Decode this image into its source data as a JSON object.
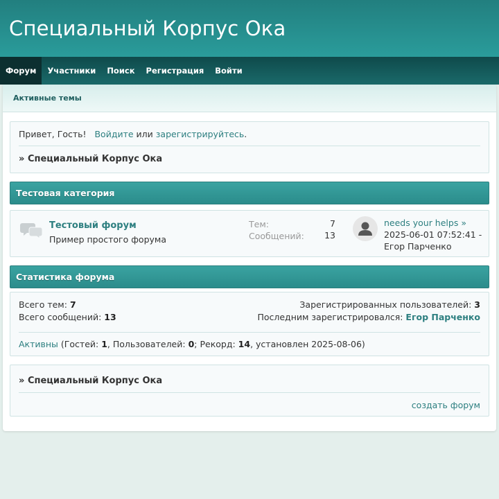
{
  "site": {
    "title": "Специальный Корпус Ока"
  },
  "nav": [
    {
      "label": "Форум",
      "active": true
    },
    {
      "label": "Участники"
    },
    {
      "label": "Поиск"
    },
    {
      "label": "Регистрация"
    },
    {
      "label": "Войти"
    }
  ],
  "active_topics_label": "Активные темы",
  "welcome": {
    "greeting": "Привет, Гость!",
    "login_link": "Войдите",
    "or": "или",
    "register_link": "зарегистрируйтесь",
    "period": "."
  },
  "breadcrumb": {
    "arrow": "»",
    "title": "Специальный Корпус Ока"
  },
  "category": {
    "title": "Тестовая категория",
    "forum": {
      "icon": "speech-bubbles-icon",
      "name": "Тестовый форум",
      "description": "Пример простого форума",
      "topics_label": "Тем:",
      "topics_count": "7",
      "posts_label": "Сообщений:",
      "posts_count": "13",
      "last_post": {
        "avatar_icon": "default-user-avatar-icon",
        "title": "needs your helps",
        "arrow": "»",
        "datetime": "2025-06-01 07:52:41 -",
        "author": "Егор Парченко"
      }
    }
  },
  "stats": {
    "title": "Статистика форума",
    "total_topics_label": "Всего тем:",
    "total_topics": "7",
    "total_posts_label": "Всего сообщений:",
    "total_posts": "13",
    "registered_label": "Зарегистрированных пользователей:",
    "registered": "3",
    "last_registered_label": "Последним зарегистрировался:",
    "last_registered": "Егор Парченко",
    "online": {
      "active_link": "Активны",
      "guests_label": "(Гостей:",
      "guests": "1",
      "users_label": ", Пользователей:",
      "users": "0",
      "record_label": "; Рекорд:",
      "record": "14",
      "record_date": ", установлен 2025-08-06)"
    }
  },
  "footer": {
    "arrow": "»",
    "title": "Специальный Корпус Ока",
    "create_forum": "создать форум"
  },
  "colors": {
    "header": "#2a9c9b",
    "nav": "#1a6a6a",
    "nav_active": "#0c2f30",
    "link": "#2d7f80",
    "category_header": "#3aa3a1",
    "page_bg": "#e4efec"
  }
}
